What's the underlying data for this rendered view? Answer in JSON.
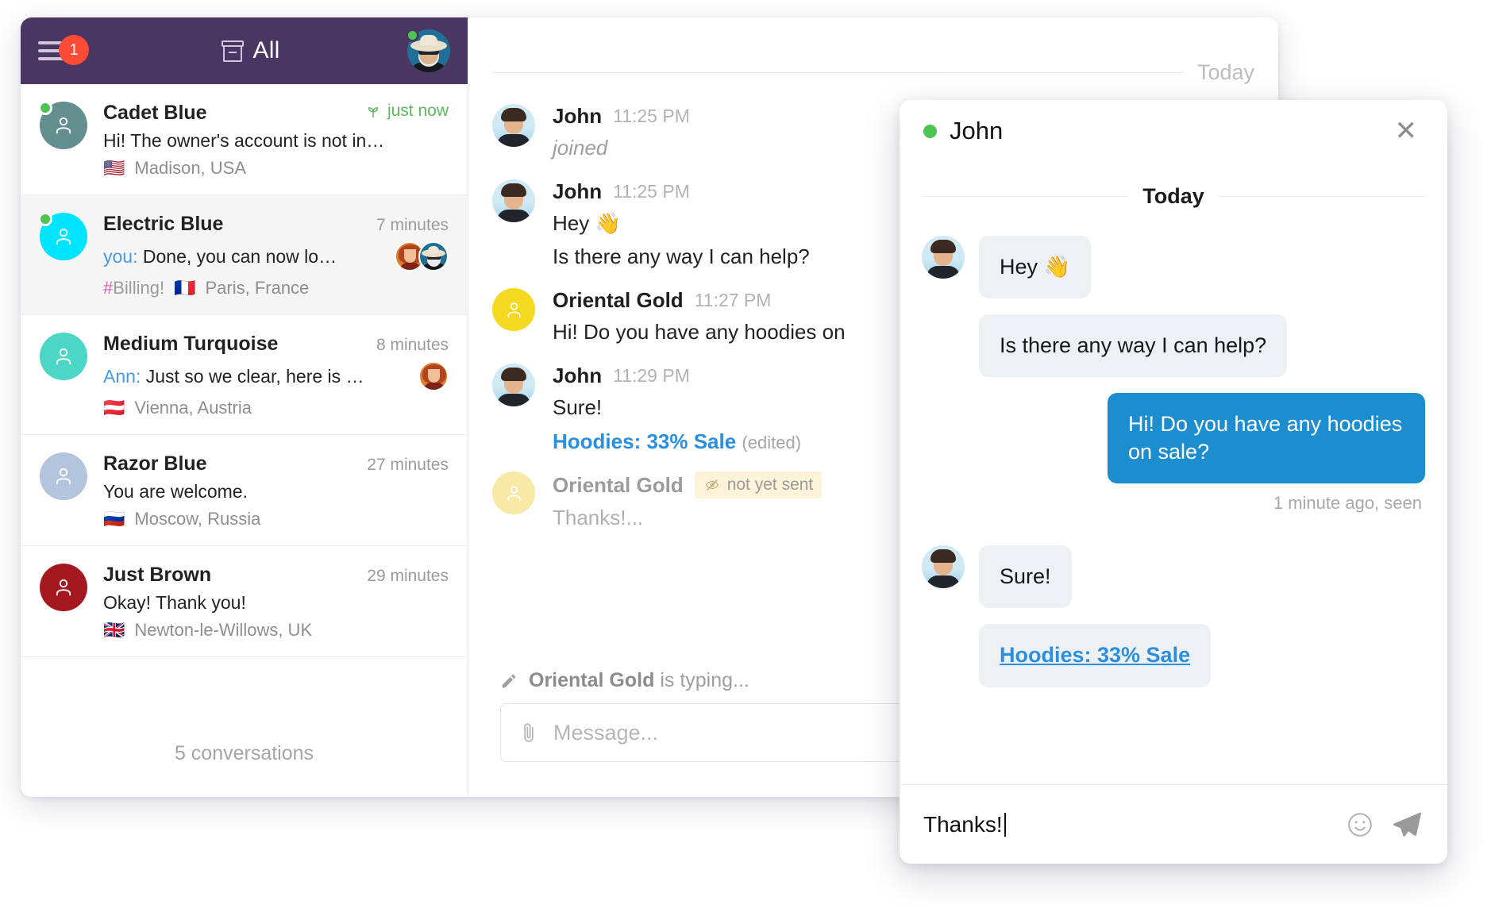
{
  "sidebar": {
    "header": {
      "menu_badge": "1",
      "filter_label": "All",
      "menu_icon": "hamburger-icon",
      "archive_icon": "archive-box-icon",
      "avatar_icon": "user-avatar-photo"
    },
    "conversations": [
      {
        "name": "Cadet Blue",
        "time": "just now",
        "time_fresh": true,
        "time_icon": "sprout-icon",
        "preview_author": "",
        "preview": "Hi! The owner's account is not in…",
        "flag": "🇺🇸",
        "location": "Madison, USA",
        "tag": "",
        "online": true,
        "active": false,
        "avatar_color": "#63908f",
        "mini_avatars": []
      },
      {
        "name": "Electric Blue",
        "time": "7 minutes",
        "time_fresh": false,
        "preview_author": "you:",
        "preview": "Done, you can now lo…",
        "flag": "🇫🇷",
        "location": "Paris, France",
        "tag": "Billing!",
        "online": true,
        "active": true,
        "avatar_color": "#00e5ff",
        "mini_avatars": [
          "woman",
          "cowboy"
        ]
      },
      {
        "name": "Medium Turquoise",
        "time": "8 minutes",
        "time_fresh": false,
        "preview_author": "Ann:",
        "preview": "Just so we clear, here is …",
        "flag": "🇦🇹",
        "location": "Vienna, Austria",
        "tag": "",
        "online": false,
        "active": false,
        "avatar_color": "#4cd6c6",
        "mini_avatars": [
          "woman"
        ]
      },
      {
        "name": "Razor Blue",
        "time": "27 minutes",
        "time_fresh": false,
        "preview_author": "",
        "preview": "You are welcome.",
        "flag": "🇷🇺",
        "location": "Moscow, Russia",
        "tag": "",
        "online": false,
        "active": false,
        "avatar_color": "#b3c4dd",
        "mini_avatars": []
      },
      {
        "name": "Just Brown",
        "time": "29 minutes",
        "time_fresh": false,
        "preview_author": "",
        "preview": "Okay! Thank you!",
        "flag": "🇬🇧",
        "location": "Newton-le-Willows, UK",
        "tag": "",
        "online": false,
        "active": false,
        "avatar_color": "#a4191f",
        "mini_avatars": []
      }
    ],
    "footer": "5 conversations"
  },
  "chat": {
    "day_separator": "Today",
    "messages": [
      {
        "author": "John",
        "time": "11:25 PM",
        "text": "joined",
        "kind": "system",
        "avatar": "john"
      },
      {
        "author": "John",
        "time": "11:25 PM",
        "text": "Hey 👋",
        "text2": "Is there any way I can help?",
        "kind": "normal",
        "avatar": "john"
      },
      {
        "author": "Oriental Gold",
        "time": "11:27 PM",
        "text": "Hi! Do you have any hoodies on",
        "kind": "normal",
        "avatar": "gold"
      },
      {
        "author": "John",
        "time": "11:29 PM",
        "text": "Sure!",
        "link": "Hoodies: 33% Sale",
        "edited": "(edited)",
        "kind": "normal",
        "avatar": "john"
      },
      {
        "author": "Oriental Gold",
        "badge": "not yet sent",
        "badge_icon": "eye-slash-icon",
        "text": "Thanks!...",
        "kind": "pending",
        "avatar": "gold-pale"
      }
    ],
    "typing_indicator": {
      "icon": "pencil-icon",
      "who": "Oriental Gold",
      "suffix": "is typing..."
    },
    "composer": {
      "attach_icon": "paperclip-icon",
      "placeholder": "Message..."
    }
  },
  "popup": {
    "status_icon": "online-dot",
    "title": "John",
    "close_label": "✕",
    "day_separator": "Today",
    "bubbles": [
      {
        "side": "them",
        "text": "Hey 👋",
        "avatar": true
      },
      {
        "side": "them",
        "text": "Is there any way I can help?",
        "avatar": false
      },
      {
        "side": "own",
        "text": "Hi! Do you have any hoodies on sale?",
        "meta": "1 minute ago, seen"
      },
      {
        "side": "them",
        "text": "Sure!",
        "avatar": true
      },
      {
        "side": "them",
        "text": "Hoodies: 33% Sale",
        "avatar": false,
        "link": true
      }
    ],
    "composer": {
      "value": "Thanks!",
      "emoji_icon": "smiley-icon",
      "send_icon": "send-paper-plane-icon"
    }
  }
}
